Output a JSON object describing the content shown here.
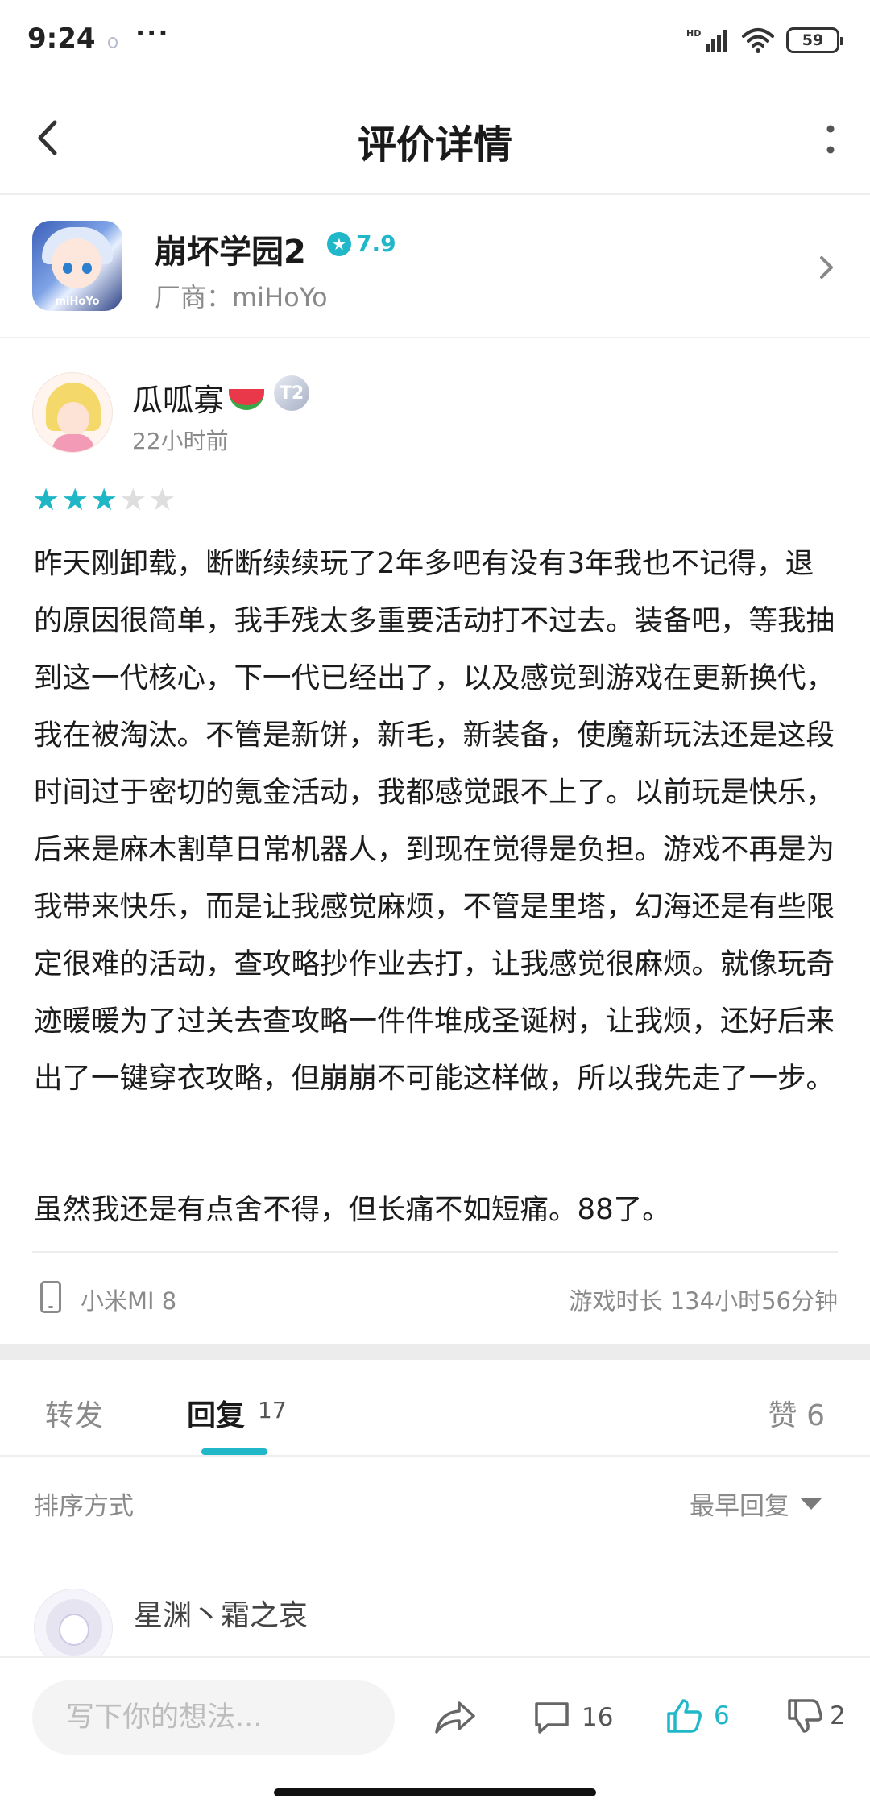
{
  "status_bar": {
    "time": "9:24",
    "more": "···",
    "hd_label": "HD",
    "battery": "59"
  },
  "nav": {
    "title": "评价详情"
  },
  "app": {
    "name": "崩坏学园2",
    "rating": "7.9",
    "vendor": "厂商：miHoYo",
    "icon_logo": "miHoYo"
  },
  "review": {
    "user_name": "瓜呱寡",
    "level_badge": "T2",
    "time": "22小时前",
    "stars": 3,
    "stars_max": 5,
    "paragraph1": "昨天刚卸载，断断续续玩了2年多吧有没有3年我也不记得，退的原因很简单，我手残太多重要活动打不过去。装备吧，等我抽到这一代核心，下一代已经出了，以及感觉到游戏在更新换代，我在被淘汰。不管是新饼，新毛，新装备，使魔新玩法还是这段时间过于密切的氪金活动，我都感觉跟不上了。以前玩是快乐，后来是麻木割草日常机器人，到现在觉得是负担。游戏不再是为我带来快乐，而是让我感觉麻烦，不管是里塔，幻海还是有些限定很难的活动，查攻略抄作业去打，让我感觉很麻烦。就像玩奇迹暖暖为了过关去查攻略一件件堆成圣诞树，让我烦，还好后来出了一键穿衣攻略，但崩崩不可能这样做，所以我先走了一步。",
    "paragraph2": "虽然我还是有点舍不得，但长痛不如短痛。88了。",
    "device": "小米MI 8",
    "play_time": "游戏时长 134小时56分钟"
  },
  "tabs": {
    "forward": "转发",
    "reply": "回复",
    "reply_count": "17",
    "like": "赞 6"
  },
  "sort": {
    "label": "排序方式",
    "value": "最早回复"
  },
  "replies": [
    {
      "name": "星渊丶霜之哀"
    }
  ],
  "bottom_bar": {
    "placeholder": "写下你的想法...",
    "comment_count": "16",
    "like_count": "6",
    "dislike_count": "2"
  },
  "colors": {
    "accent": "#20b8c8",
    "muted_text": "#8a8a8a",
    "star_off": "#dedede"
  },
  "icons": [
    "back-icon",
    "more-vertical-icon",
    "rating-star-icon",
    "chevron-right-icon",
    "phone-icon",
    "dropdown-caret-icon",
    "share-icon",
    "comment-icon",
    "thumbs-up-icon",
    "thumbs-down-icon"
  ]
}
